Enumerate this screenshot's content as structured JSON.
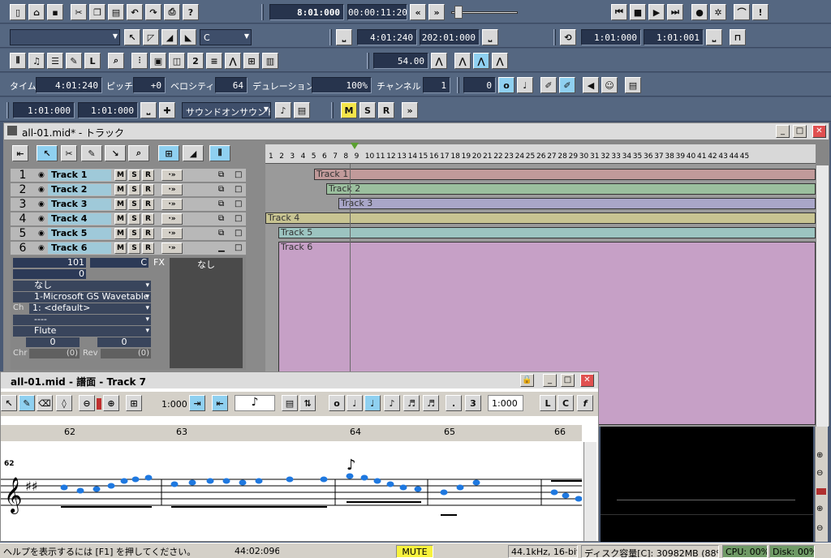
{
  "toolbar1": {
    "time": "8:01:000",
    "time2": "00:00:11:20"
  },
  "toolbar2": {
    "key": "C",
    "from": "4:01:240",
    "to": "202:01:000",
    "loop_from": "1:01:000",
    "loop_to": "1:01:001"
  },
  "toolbar3": {
    "tempo": "54.00"
  },
  "toolbar4": {
    "time_label": "タイム",
    "time_value": "4:01:240",
    "pitch_label": "ピッチ",
    "pitch_value": "+0",
    "velocity_label": "ベロシティ",
    "velocity_value": "64",
    "duration_label": "デュレーション",
    "duration_value": "100%",
    "channel_label": "チャンネル",
    "channel_value": "1",
    "extra_value": "0"
  },
  "toolbar5": {
    "from": "1:01:000",
    "to": "1:01:000",
    "sound_select": "サウンドオンサウンド",
    "m": "M",
    "s": "S",
    "r": "R"
  },
  "track_window": {
    "title": "all-01.mid* - トラック",
    "ruler": [
      "1",
      "2",
      "3",
      "4",
      "5",
      "6",
      "7",
      "8",
      "9",
      "10",
      "11",
      "12",
      "13",
      "14",
      "15",
      "16",
      "17",
      "18",
      "19",
      "20",
      "21",
      "22",
      "23",
      "24",
      "25",
      "26",
      "27",
      "28",
      "29",
      "30",
      "31",
      "32",
      "33",
      "34",
      "35",
      "36",
      "37",
      "38",
      "39",
      "40",
      "41",
      "42",
      "43",
      "44",
      "45"
    ],
    "tracks": [
      {
        "num": "1",
        "name": "Track 1"
      },
      {
        "num": "2",
        "name": "Track 2"
      },
      {
        "num": "3",
        "name": "Track 3"
      },
      {
        "num": "4",
        "name": "Track 4"
      },
      {
        "num": "5",
        "name": "Track 5"
      },
      {
        "num": "6",
        "name": "Track 6"
      }
    ],
    "msr": {
      "m": "M",
      "s": "S",
      "r": "R"
    },
    "inspector": {
      "volume": "101",
      "pan": "C",
      "fx_label": "FX",
      "fx_value": "なし",
      "aux": "0",
      "input": "なし",
      "output": "1-Microsoft GS Wavetable",
      "ch_label": "Ch",
      "ch": "1: <default>",
      "bank": "----",
      "patch": "Flute",
      "key_offset": "0",
      "vel_offset": "0",
      "chr_label": "Chr",
      "chr": "(0)",
      "rev_label": "Rev",
      "rev": "(0)"
    },
    "clip_colors": [
      "#c19a9a",
      "#9bbf9e",
      "#a9a6c8",
      "#c8c492",
      "#9cc4c0",
      "#c6a0c6"
    ]
  },
  "score_window": {
    "title": "all-01.mid - 譜面 - Track 7",
    "grid1": "1:000",
    "grid2": "1:000",
    "ruler": [
      "62",
      "63",
      "64",
      "65",
      "66"
    ],
    "measure_num": "62",
    "tools": {
      "l": "L",
      "c": "C",
      "f": "f",
      "dot": ".",
      "triplet": "3"
    }
  },
  "status_bar": {
    "help": "ヘルプを表示するには [F1] を押してください。",
    "time": "44:02:096",
    "mute": "MUTE",
    "audio": "44.1kHz, 16-bit",
    "disk": "ディスク容量[C]: 30982MB (88%)",
    "cpu": "CPU: 00%",
    "disk_io": "Disk: 00%"
  }
}
